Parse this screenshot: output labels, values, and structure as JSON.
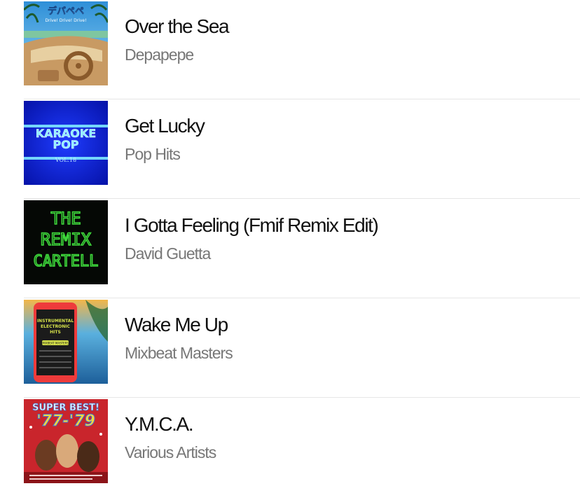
{
  "songs": [
    {
      "title": "Over the Sea",
      "artist": "Depapepe",
      "art": {
        "icon": "convertible-car-dashboard-art",
        "text": "デパペペ",
        "subtext": "Drive! Drive! Drive!",
        "colors": [
          "#3da6e0",
          "#b98953",
          "#e8d2a6"
        ]
      }
    },
    {
      "title": "Get Lucky",
      "artist": "Pop Hits",
      "art": {
        "icon": "karaoke-pop-neon-art",
        "line1": "KARAOKE",
        "line2": "POP",
        "line3": "VOL.18",
        "colors": [
          "#0a1bd6",
          "#5fe0ff",
          "#ffffff"
        ]
      }
    },
    {
      "title": "I Gotta Feeling (Fmif Remix Edit)",
      "artist": "David Guetta",
      "art": {
        "icon": "remix-cartell-neon-art",
        "line1": "THE",
        "line2": "REMIX",
        "line3": "CARTELL",
        "colors": [
          "#050805",
          "#3dd63a"
        ]
      }
    },
    {
      "title": "Wake Me Up",
      "artist": "Mixbeat Masters",
      "art": {
        "icon": "phone-beach-art",
        "line1": "INSTRUMENTAL",
        "line2": "ELECTRONIC",
        "line3": "HITS",
        "badge": "MIXBEAT MASTERS",
        "colors": [
          "#2b8fc9",
          "#ee3b3b",
          "#d6e24a"
        ]
      }
    },
    {
      "title": "Y.M.C.A.",
      "artist": "Various Artists",
      "art": {
        "icon": "super-best-disco-art",
        "line1": "SUPER BEST!",
        "line2": "'77-'79",
        "colors": [
          "#c9252c",
          "#ffd83a",
          "#3a78d8"
        ]
      }
    }
  ]
}
